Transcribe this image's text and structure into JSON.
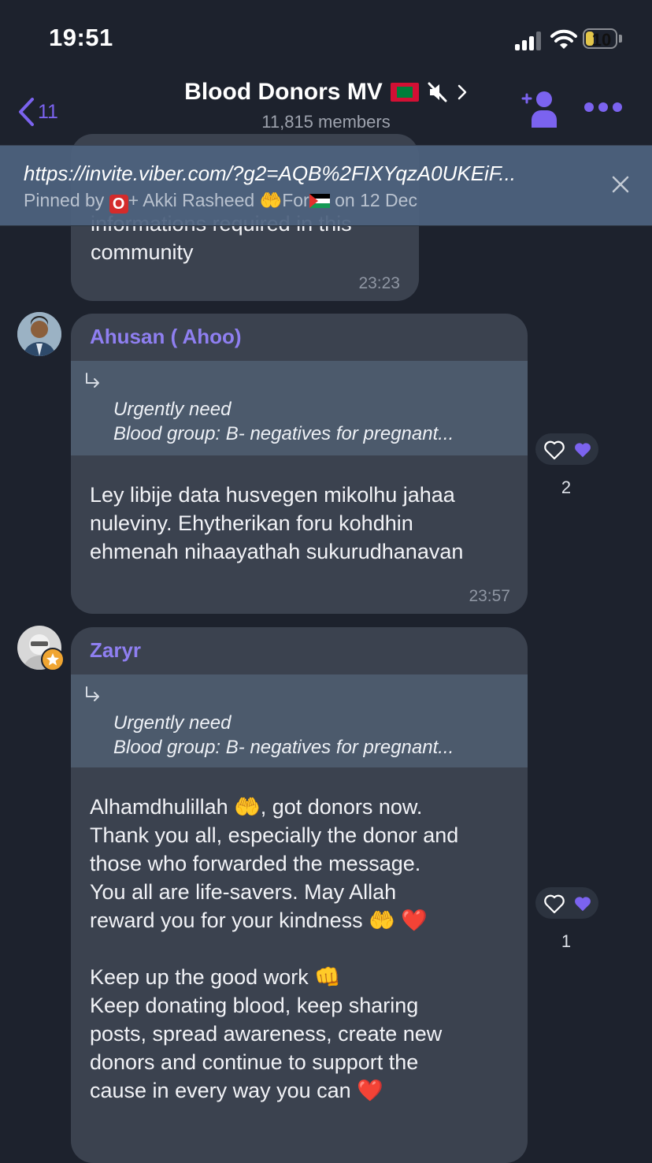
{
  "status": {
    "time": "19:51",
    "battery": "10"
  },
  "header": {
    "back_count": "11",
    "title": "Blood Donors MV",
    "members": "11,815 members"
  },
  "pinned": {
    "link": "https://invite.viber.com/?g2=AQB%2FIXYqzA0UKEiF...",
    "prefix": "Pinned by",
    "pinner_badge": "O",
    "pinner_name": "+ Akki Rasheed",
    "after_emoji": "For",
    "suffix": "on 12 Dec"
  },
  "messages": [
    {
      "text": "informations required in this\ncommunity",
      "time": "23:23"
    },
    {
      "sender": "Ahusan ( Ahoo)",
      "quote_line1": "Urgently need",
      "quote_line2": "Blood group: B- negatives for pregnant...",
      "text": "Ley libije data husvegen mikolhu jahaa\nnuleviny. Ehytherikan foru kohdhin\nehmenah nihaayathah sukurudhanavan",
      "time": "23:57",
      "reaction_count": "2"
    },
    {
      "sender": "Zaryr",
      "quote_line1": "Urgently need",
      "quote_line2": "Blood group: B- negatives for pregnant...",
      "line1a": "Alhamdhulillah ",
      "line1b": ", got donors now.",
      "text_mid": "Thank you all, especially the donor and\nthose who forwarded the message.\nYou all are life-savers. May Allah",
      "line5": "reward you for your kindness ",
      "line7": "Keep up the good work ",
      "text_end": "Keep donating blood, keep sharing\nposts, spread awareness, create new\ndonors and continue to support the",
      "line_last": "cause in every way you can ",
      "reaction_count": "1"
    }
  ],
  "colors": {
    "accent": "#7b63ef",
    "background": "#1d222d",
    "bubble": "#3b424f",
    "quote": "#4c5a6c",
    "pinned": "#4e627e"
  },
  "icons": [
    "back-chevron-icon",
    "mute-icon",
    "chevron-right-icon",
    "add-member-icon",
    "more-icon",
    "close-icon",
    "reply-arrow-icon",
    "heart-outline-icon",
    "heart-filled-icon",
    "raising-hands-emoji",
    "red-heart-emoji",
    "fist-bump-emoji"
  ]
}
